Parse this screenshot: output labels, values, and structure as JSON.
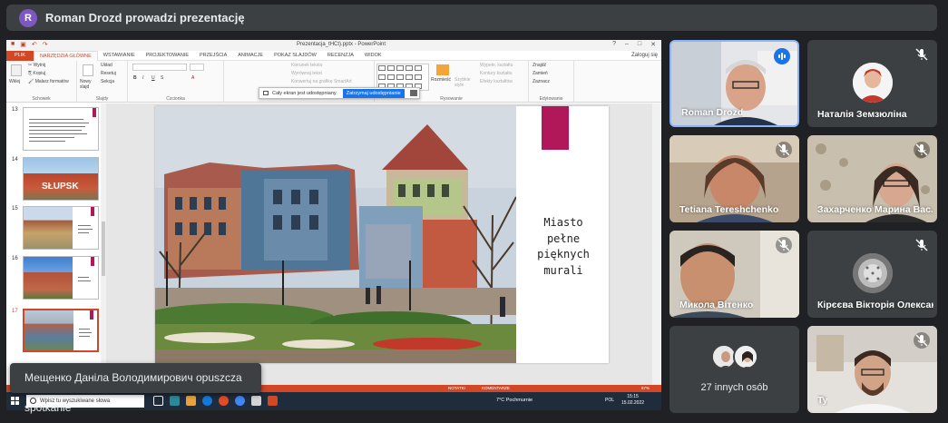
{
  "presenter_bar": {
    "initial": "R",
    "text": "Roman Drozd prowadzi prezentację",
    "avatar_color": "#7e57c2"
  },
  "powerpoint": {
    "title": "Prezentacja_tHCt).pptx - PowerPoint",
    "login": "Zaloguj się",
    "tabs": [
      "PLIK",
      "NARZĘDZIA GŁÓWNE",
      "WSTAWIANIE",
      "PROJEKTOWANIE",
      "PRZEJŚCIA",
      "ANIMACJE",
      "POKAZ SLAJDÓW",
      "RECENZJA",
      "WIDOK"
    ],
    "ribbon": {
      "paste": "Wklej",
      "cut": "Wytnij",
      "copy": "Kopiuj",
      "format_painter": "Malarz formatów",
      "clipboard": "Schowek",
      "new_slide": "Nowy slajd",
      "layout": "Układ",
      "reset": "Resetuj",
      "section": "Sekcja",
      "slides": "Slajdy",
      "font": "Czcionka",
      "text_direction": "Kierunek tekstu",
      "align_text": "Wyrównaj tekst",
      "convert_smartart": "Konwertuj na grafikę SmartArt",
      "arrange": "Rozmieść",
      "quick_styles": "Szybkie style",
      "drawing": "Rysowanie",
      "shape_fill": "Wypełn. kształtu",
      "shape_outline": "Kontury kształtu",
      "shape_effects": "Efekty kształtów",
      "find": "Znajdź",
      "replace": "Zamień",
      "select": "Zaznacz",
      "editing": "Edytowanie"
    },
    "share_notice": {
      "text": "Cały ekran jest udostępniany.",
      "stop_button": "Zatrzymaj udostępnianie"
    },
    "thumbnails": [
      {
        "num": "13",
        "selected": false
      },
      {
        "num": "14",
        "selected": false
      },
      {
        "num": "15",
        "selected": false
      },
      {
        "num": "16",
        "selected": false
      },
      {
        "num": "17",
        "selected": true
      }
    ],
    "slide_text": [
      "Miasto",
      "pełne",
      "pięknych",
      "murali"
    ],
    "status": {
      "notes": "NOTATKI",
      "comments": "KOMENTARZE",
      "zoom": "67%"
    },
    "accent_color": "#d24726",
    "slide_accent_color": "#b0185a"
  },
  "taskbar": {
    "search_placeholder": "Wpisz tu wyszukiwane słowa",
    "weather": "7°C  Pochmurnie",
    "lang": "POL",
    "time": "15:15",
    "date": "15.02.2022"
  },
  "toast": {
    "text": "Мещенко Данiла Володимирович opuszcza spotkanie"
  },
  "participants": [
    {
      "name": "Roman Drozd",
      "speaking": true
    },
    {
      "name": "Наталія Земзюліна",
      "muted": true
    },
    {
      "name": "Tetiana Tereshchenko",
      "muted": true
    },
    {
      "name": "Захарченко Марина Вас...",
      "muted": true
    },
    {
      "name": "Микола Вітенко",
      "muted": true
    },
    {
      "name": "Кірєєва Вікторія Олексан...",
      "muted": true
    },
    {
      "name": "27 innych osób"
    },
    {
      "name": "Ty",
      "muted": true
    }
  ]
}
